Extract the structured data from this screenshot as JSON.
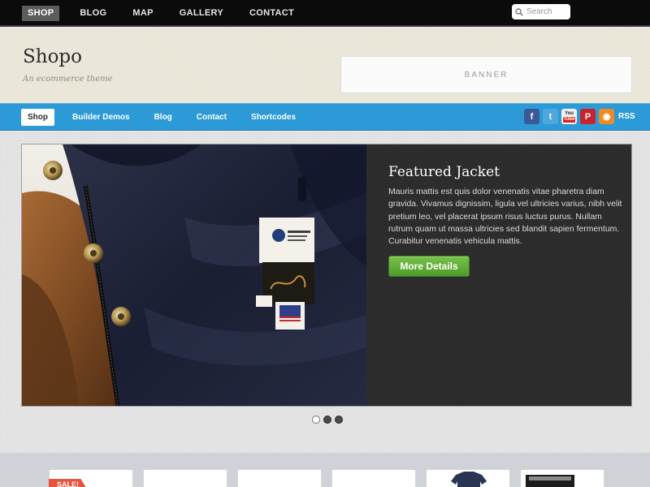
{
  "topnav": {
    "items": [
      {
        "label": "SHOP",
        "active": true
      },
      {
        "label": "BLOG",
        "active": false
      },
      {
        "label": "MAP",
        "active": false
      },
      {
        "label": "GALLERY",
        "active": false
      },
      {
        "label": "CONTACT",
        "active": false
      }
    ],
    "search_placeholder": "Search"
  },
  "header": {
    "title": "Shopo",
    "tagline": "An ecommerce theme",
    "banner": "BANNER"
  },
  "mainnav": {
    "items": [
      {
        "label": "Shop",
        "active": true
      },
      {
        "label": "Builder Demos",
        "active": false
      },
      {
        "label": "Blog",
        "active": false
      },
      {
        "label": "Contact",
        "active": false
      },
      {
        "label": "Shortcodes",
        "active": false
      }
    ],
    "social": [
      {
        "icon": "facebook-icon",
        "glyph": "f",
        "color": "#3b5998"
      },
      {
        "icon": "twitter-icon",
        "glyph": "t",
        "color": "#4fa8dd"
      },
      {
        "icon": "youtube-icon",
        "glyph": "You",
        "glyph2": "Tube",
        "color": "#d8231f"
      },
      {
        "icon": "pinterest-icon",
        "glyph": "P",
        "color": "#c8232c"
      },
      {
        "icon": "rss-icon",
        "glyph": "◉",
        "color": "#f08a24"
      }
    ],
    "rss_label": "RSS"
  },
  "slider": {
    "title": "Featured Jacket",
    "text": "Mauris mattis est quis dolor venenatis vitae pharetra diam gravida. Vivamus dignissim, ligula vel ultricies varius, nibh velit pretium leo, vel placerat ipsum risus luctus purus. Nullam rutrum quam ut massa ultricies sed blandit sapien fermentum. Curabitur venenatis vehicula mattis.",
    "button": "More Details",
    "image_icon": "jacket-photo",
    "slides_total": 3,
    "current_slide": 1
  },
  "products": {
    "first_badge": "SALE!"
  },
  "colors": {
    "nav_blue": "#2c9ad7",
    "button_green": "#5aa933",
    "sale_red": "#e4553b"
  }
}
